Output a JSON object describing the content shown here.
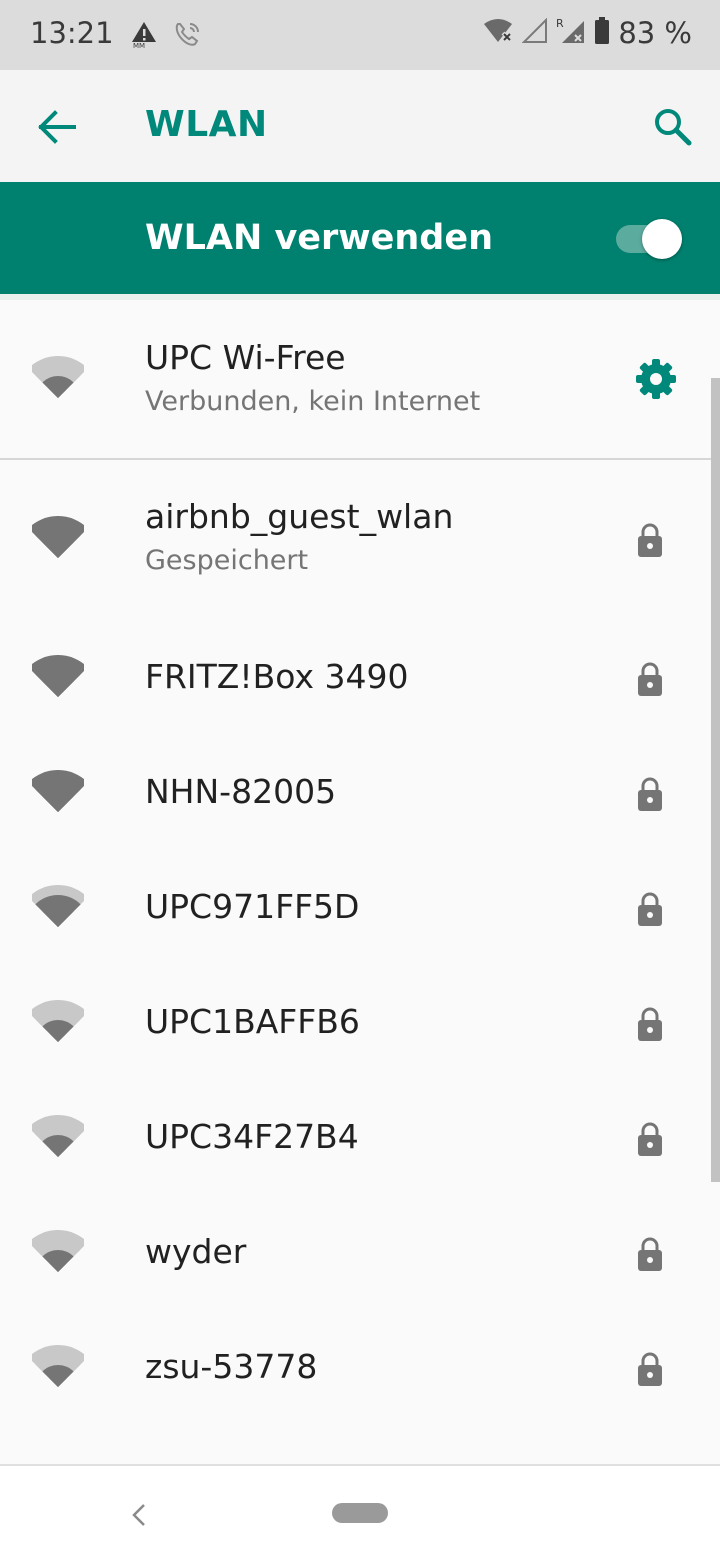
{
  "status_bar": {
    "time": "13:21",
    "battery": "83 %",
    "icons": [
      "warning-icon",
      "wifi-calling-icon",
      "wifi-off-icon",
      "signal-empty-icon",
      "signal-roaming-icon",
      "battery-icon"
    ]
  },
  "app_bar": {
    "title": "WLAN",
    "back_icon": "arrow-back-icon",
    "search_icon": "search-icon"
  },
  "master": {
    "label": "WLAN verwenden",
    "enabled": true
  },
  "colors": {
    "accent": "#00897b",
    "master_background": "#00806e",
    "icon_strong": "#757575",
    "icon_weak": "#c8c8c8"
  },
  "networks": [
    {
      "name": "UPC Wi-Free",
      "subtitle": "Verbunden, kein Internet",
      "signal_bars": 2,
      "secured": false,
      "connected": true
    },
    {
      "name": "airbnb_guest_wlan",
      "subtitle": "Gespeichert",
      "signal_bars": 4,
      "secured": true
    },
    {
      "name": "FRITZ!Box 3490",
      "subtitle": "",
      "signal_bars": 4,
      "secured": true
    },
    {
      "name": "NHN-82005",
      "subtitle": "",
      "signal_bars": 4,
      "secured": true
    },
    {
      "name": "UPC971FF5D",
      "subtitle": "",
      "signal_bars": 3,
      "secured": true
    },
    {
      "name": "UPC1BAFFB6",
      "subtitle": "",
      "signal_bars": 2,
      "secured": true
    },
    {
      "name": "UPC34F27B4",
      "subtitle": "",
      "signal_bars": 2,
      "secured": true
    },
    {
      "name": "wyder",
      "subtitle": "",
      "signal_bars": 2,
      "secured": true
    },
    {
      "name": "zsu-53778",
      "subtitle": "",
      "signal_bars": 2,
      "secured": true
    }
  ]
}
